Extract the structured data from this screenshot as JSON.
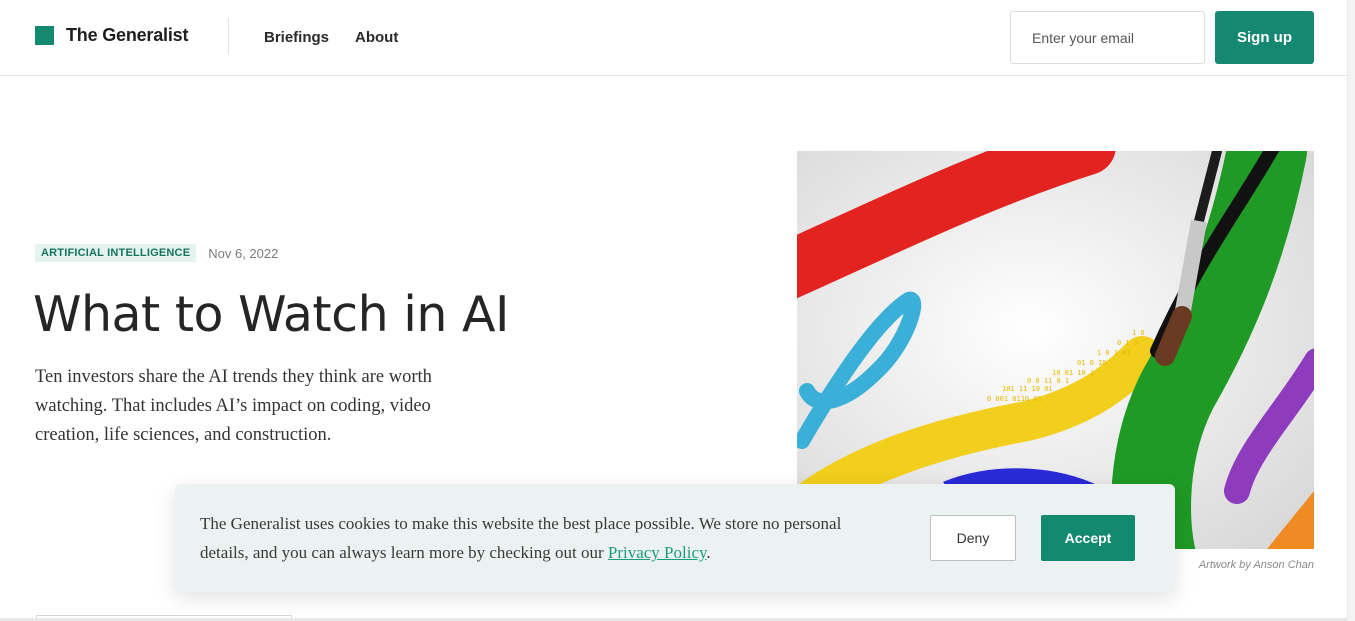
{
  "header": {
    "brand": "The Generalist",
    "nav": [
      "Briefings",
      "About"
    ],
    "email_placeholder": "Enter your email",
    "signup_label": "Sign up"
  },
  "article": {
    "category": "ARTIFICIAL INTELLIGENCE",
    "date": "Nov 6, 2022",
    "title": "What to Watch in AI",
    "deck": "Ten investors share the AI trends they think are worth watching. That includes AI’s impact on coding, video creation, life sciences, and construction.",
    "image_credit": "Artwork by Anson Chan"
  },
  "cookie_banner": {
    "text": "The Generalist uses cookies to make this website the best place possible. We store no personal details, and you can always learn more by checking out our ",
    "link_text": "Privacy Policy",
    "suffix": ".",
    "deny_label": "Deny",
    "accept_label": "Accept"
  },
  "colors": {
    "brand_green": "#138a6f",
    "tag_bg": "#e5f3ef",
    "banner_bg": "#ecf2f1"
  }
}
